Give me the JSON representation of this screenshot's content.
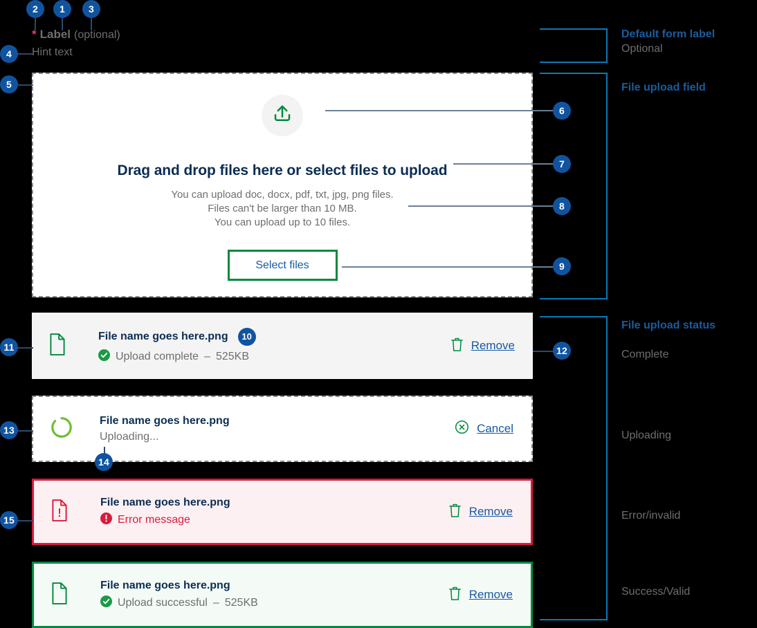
{
  "form": {
    "required_marker": "*",
    "label": "Label",
    "optional_suffix": "(optional)",
    "hint": "Hint text"
  },
  "dropzone": {
    "icon": "upload-icon",
    "title": "Drag and drop files here or select files to upload",
    "help_line_1": "You can upload doc, docx, pdf, txt, jpg, png files.",
    "help_line_2": "Files can't be larger than 10 MB.",
    "help_line_3": "You can upload up to 10 files.",
    "select_button": "Select files"
  },
  "files": {
    "complete": {
      "icon": "file-icon",
      "name": "File name goes here.png",
      "badge": "10",
      "status_icon": "check-circle-icon",
      "status": "Upload complete",
      "separator": "–",
      "size": "525KB",
      "action_icon": "trash-icon",
      "action": "Remove"
    },
    "uploading": {
      "icon": "spinner-icon",
      "name": "File name goes here.png",
      "status": "Uploading...",
      "action_icon": "circle-x-icon",
      "action": "Cancel"
    },
    "error": {
      "icon": "file-error-icon",
      "name": "File name goes here.png",
      "status_icon": "alert-circle-icon",
      "status": "Error message",
      "action_icon": "trash-icon",
      "action": "Remove"
    },
    "success": {
      "icon": "file-icon",
      "name": "File name goes here.png",
      "status_icon": "check-circle-icon",
      "status": "Upload successful",
      "separator": "–",
      "size": "525KB",
      "action_icon": "trash-icon",
      "action": "Remove"
    }
  },
  "annotations": {
    "group_1_head": "Default form label",
    "group_1_sub": "Optional",
    "group_2_head": "File upload field",
    "group_3_head": "File upload status",
    "group_3_item_1": "Complete",
    "group_3_item_2": "Uploading",
    "group_3_item_3": "Error/invalid",
    "group_3_item_4": "Success/Valid"
  },
  "callouts": {
    "c1": "1",
    "c2": "2",
    "c3": "3",
    "c4": "4",
    "c5": "5",
    "c6": "6",
    "c7": "7",
    "c8": "8",
    "c9": "9",
    "c10": "10",
    "c11": "11",
    "c12": "12",
    "c13": "13",
    "c14": "14",
    "c15": "15"
  },
  "colors": {
    "callout_blue": "#1054a0",
    "bracket_blue": "#0a7ab5",
    "green": "#008a3e",
    "error_red": "#d81b3c",
    "link_blue": "#1659a8",
    "heading_navy": "#0b2d52"
  }
}
